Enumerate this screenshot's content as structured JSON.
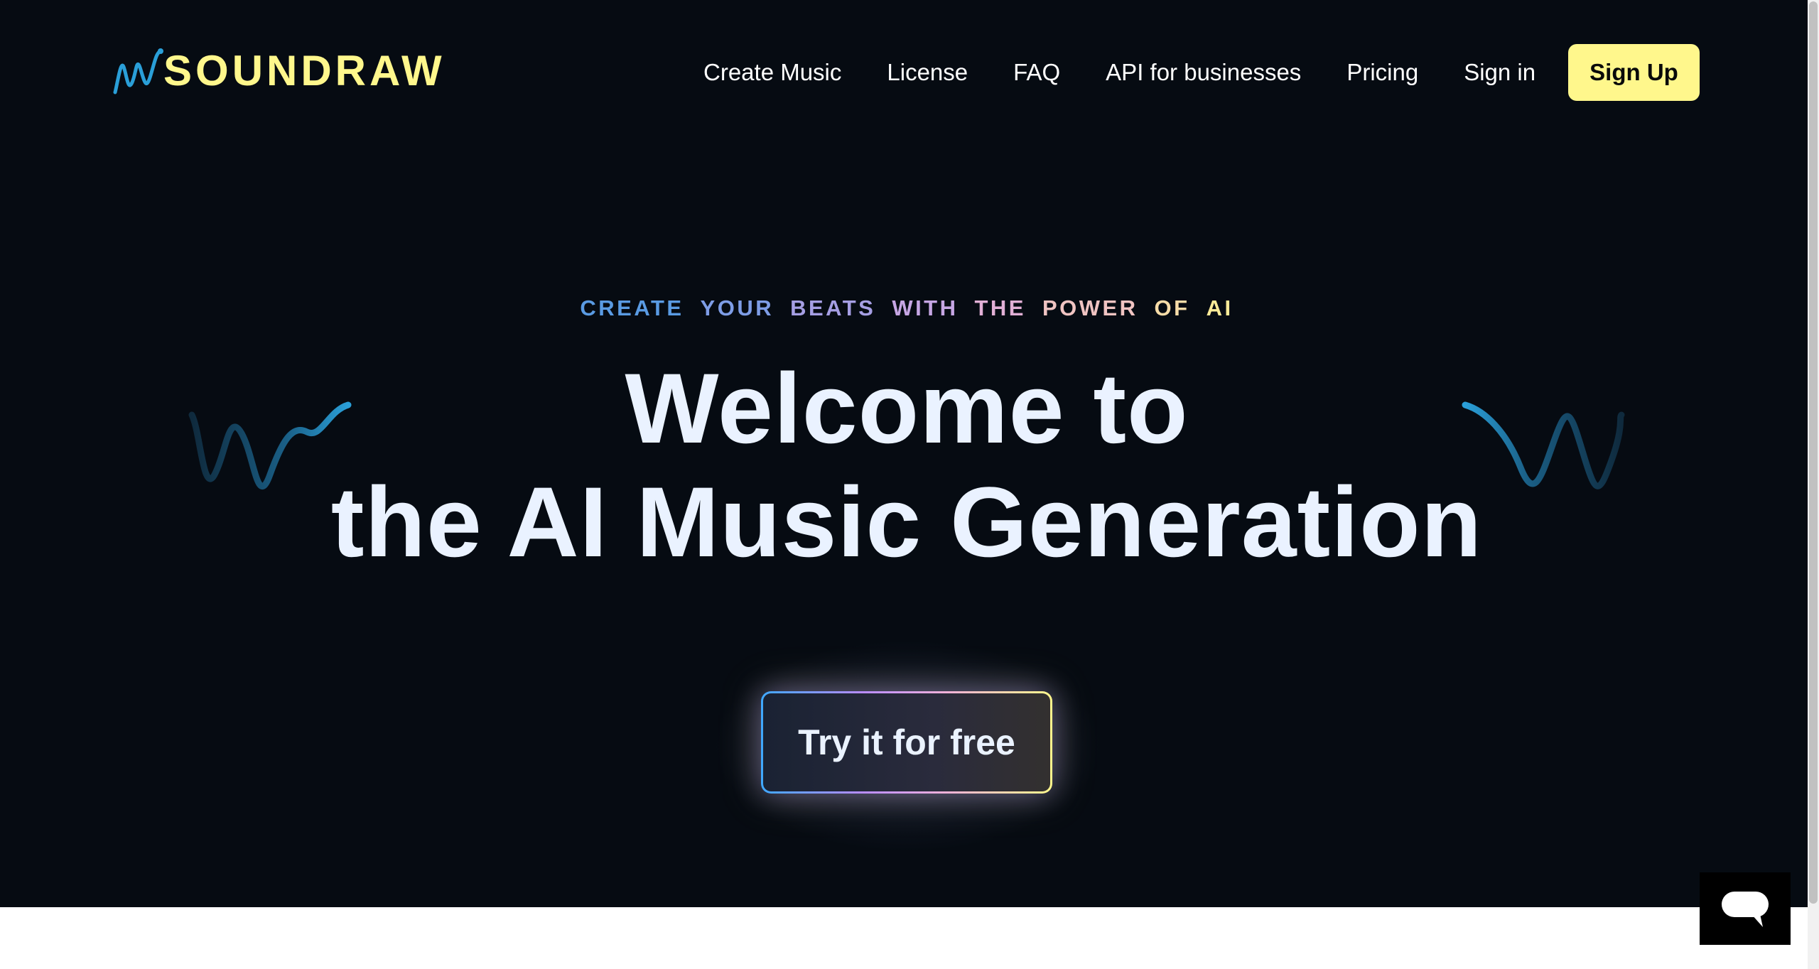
{
  "brand": {
    "name": "SOUNDRAW",
    "accent_color": "#fff78c",
    "wave_color": "#2a9fd8"
  },
  "nav": {
    "items": [
      {
        "label": "Create Music"
      },
      {
        "label": "License"
      },
      {
        "label": "FAQ"
      },
      {
        "label": "API for businesses"
      },
      {
        "label": "Pricing"
      },
      {
        "label": "Sign in"
      }
    ],
    "signup_label": "Sign Up"
  },
  "hero": {
    "eyebrow_words": [
      {
        "text": "CREATE",
        "color": "#5a9be3"
      },
      {
        "text": "YOUR",
        "color": "#7e9de6"
      },
      {
        "text": "BEATS",
        "color": "#a69fe4"
      },
      {
        "text": "WITH",
        "color": "#c6a6e4"
      },
      {
        "text": "THE",
        "color": "#e2b0d6"
      },
      {
        "text": "POWER",
        "color": "#f0c4c2"
      },
      {
        "text": "OF",
        "color": "#f6dca8"
      },
      {
        "text": "AI",
        "color": "#fbeb98"
      }
    ],
    "headline_line1": "Welcome to",
    "headline_line2": "the AI Music Generation",
    "cta_label": "Try it for free"
  },
  "chat_widget": {
    "icon": "chat-bubble-icon"
  }
}
